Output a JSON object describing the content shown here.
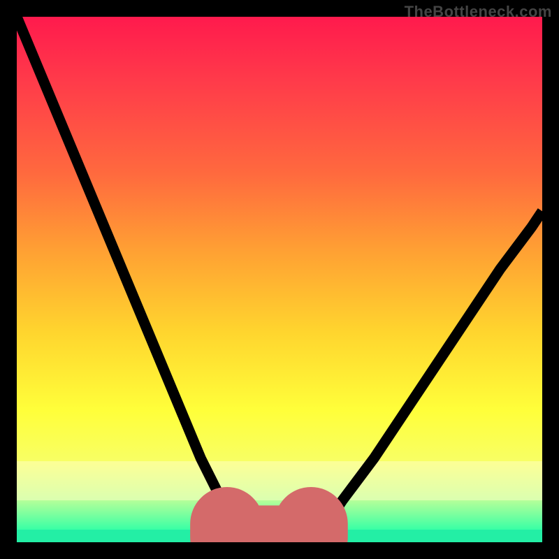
{
  "watermark": "TheBottleneck.com",
  "chart_data": {
    "type": "line",
    "title": "",
    "xlabel": "",
    "ylabel": "",
    "xlim": [
      0,
      100
    ],
    "ylim": [
      0,
      100
    ],
    "series": [
      {
        "name": "left-curve",
        "x": [
          0,
          5,
          10,
          15,
          20,
          25,
          30,
          35,
          40,
          42,
          44
        ],
        "values": [
          100,
          88,
          76,
          64,
          52,
          40,
          28,
          16,
          6,
          2,
          0
        ]
      },
      {
        "name": "right-curve",
        "x": [
          56,
          58,
          62,
          68,
          74,
          80,
          86,
          92,
          98,
          100
        ],
        "values": [
          0,
          2,
          8,
          16,
          25,
          34,
          43,
          52,
          60,
          63
        ]
      }
    ],
    "annotations": {
      "optimal_bracket": {
        "x_start": 40,
        "x_end": 56,
        "y": 0
      }
    },
    "gradient_colors": {
      "top": "#ff1a4d",
      "mid": "#ffd52e",
      "bottom": "#23efa5"
    },
    "bracket_color": "#d46a6a"
  }
}
